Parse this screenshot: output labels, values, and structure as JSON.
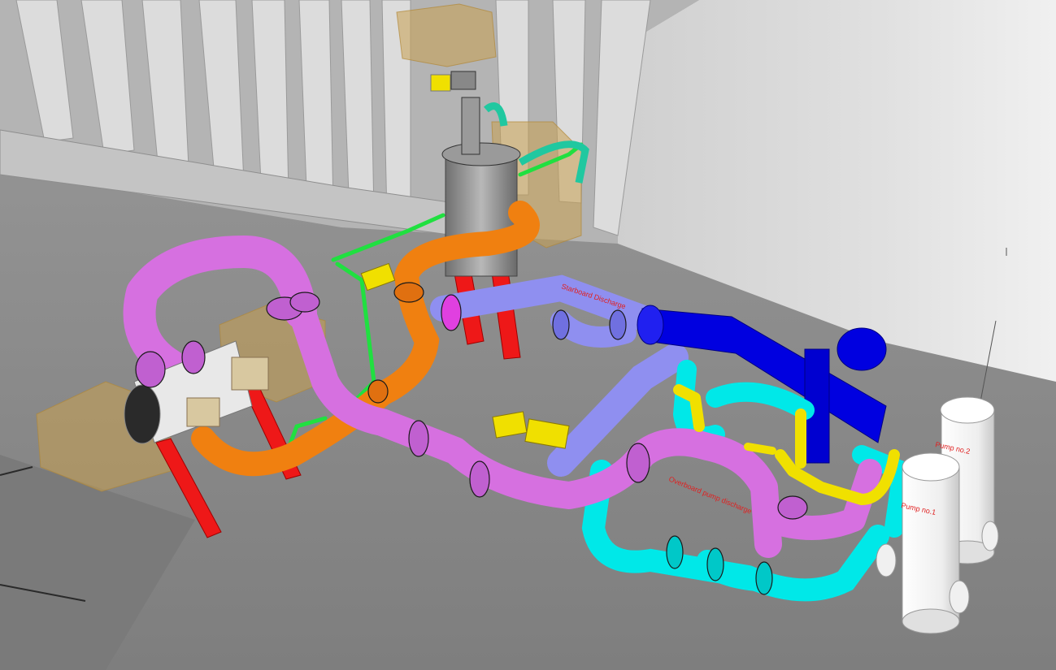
{
  "labels": {
    "starboard_discharge": "Starboard Discharge",
    "overboard_pump_discharge": "Overboard pump discharge",
    "pump_no_2": "Pump no.2",
    "pump_no_1": "Pump no.1"
  },
  "colors": {
    "hull_light": "#d8d8d8",
    "hull_mid": "#a8a8a8",
    "floor": "#8c8c8c",
    "magenta_pipe": "#d670e0",
    "orange_pipe": "#f08010",
    "lavender_pipe": "#8f8ff0",
    "blue_cooler": "#0000e0",
    "cyan_pipe": "#00e8e8",
    "yellow_pipe": "#f0e000",
    "green_line": "#20e040",
    "red_support": "#ee1818",
    "pump_white": "#f4f4f4",
    "tan_volume": "#c8a050"
  },
  "icons": [
    "pump-cylinder-icon",
    "flange-icon",
    "valve-actuator-icon"
  ]
}
